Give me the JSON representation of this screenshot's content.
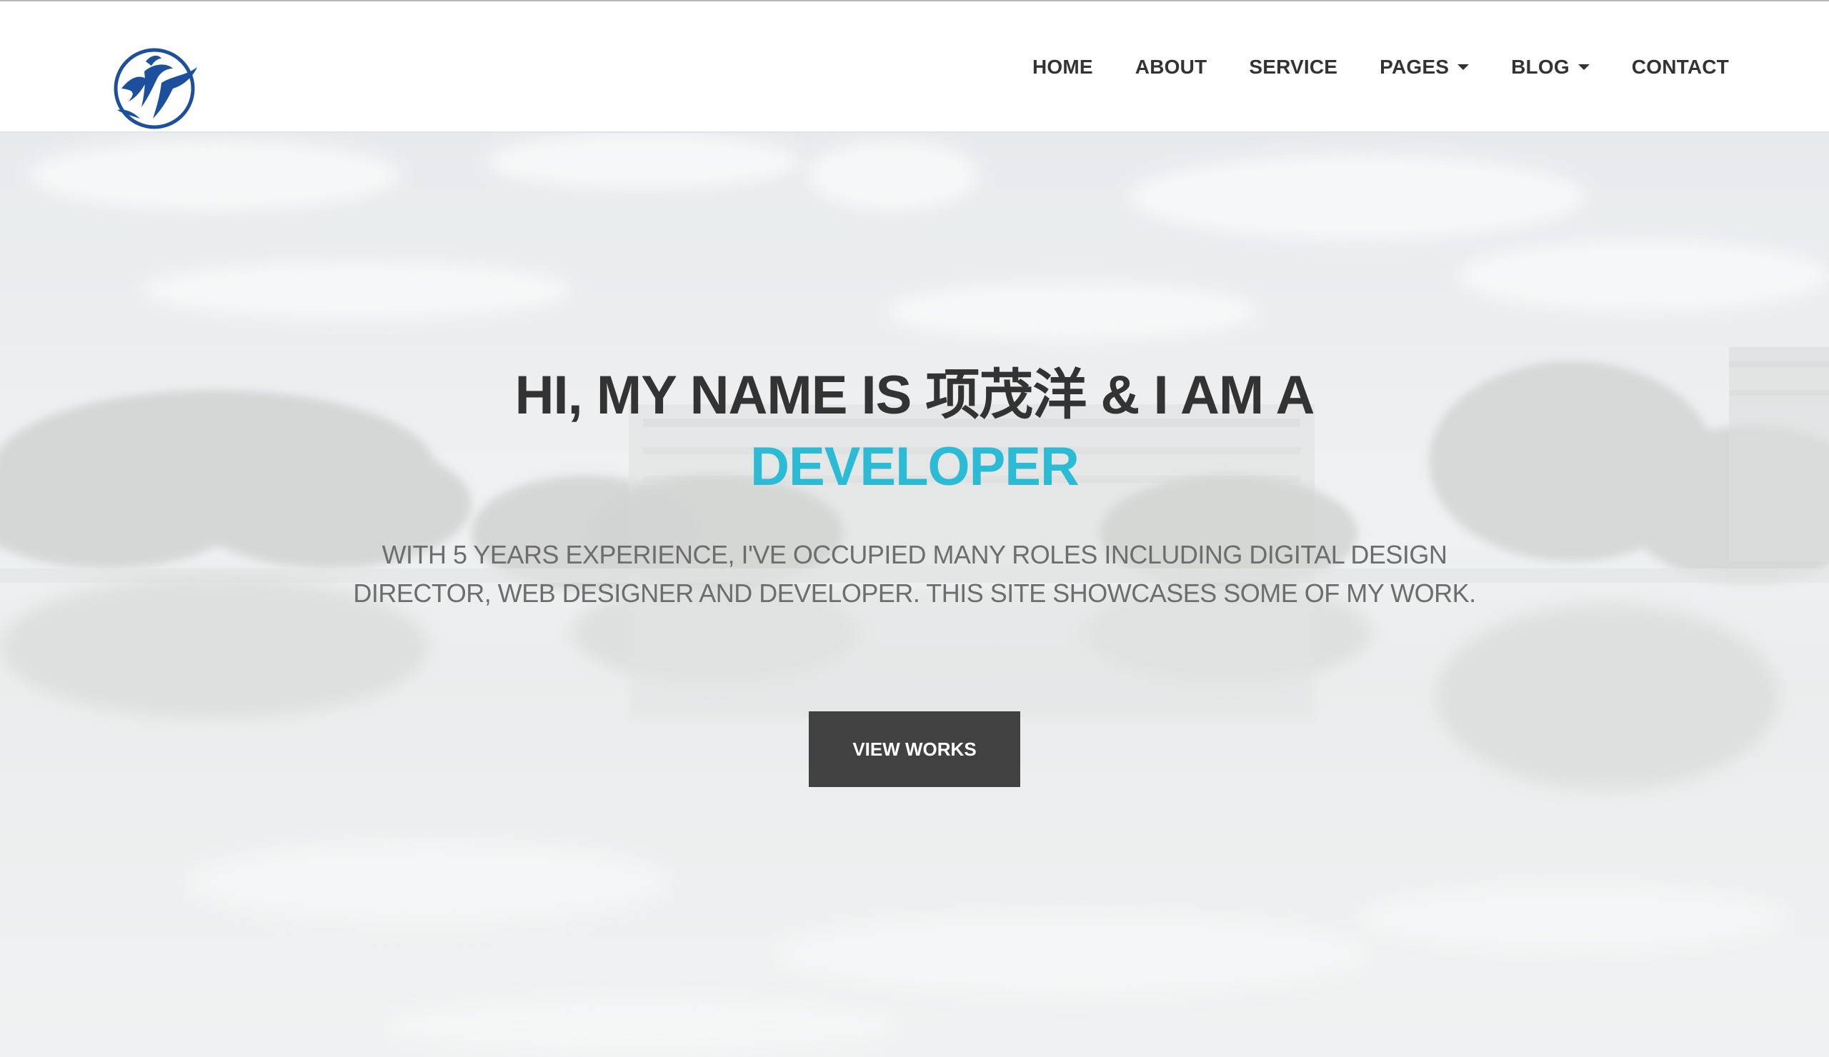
{
  "nav": {
    "items": [
      {
        "label": "HOME",
        "has_dropdown": false
      },
      {
        "label": "ABOUT",
        "has_dropdown": false
      },
      {
        "label": "SERVICE",
        "has_dropdown": false
      },
      {
        "label": "PAGES",
        "has_dropdown": true
      },
      {
        "label": "BLOG",
        "has_dropdown": true
      },
      {
        "label": "CONTACT",
        "has_dropdown": false
      }
    ],
    "logo_icon": "bird-emblem-logo"
  },
  "hero": {
    "headline": "HI, MY NAME IS 项茂洋 & I AM A",
    "role": "DEVELOPER",
    "intro": "WITH 5 YEARS EXPERIENCE, I'VE OCCUPIED MANY ROLES INCLUDING DIGITAL DESIGN DIRECTOR, WEB DESIGNER AND DEVELOPER. THIS SITE SHOWCASES SOME OF MY WORK.",
    "cta_label": "VIEW WORKS"
  },
  "colors": {
    "accent": "#2bbbd4",
    "heading": "#333333",
    "button": "#414141",
    "logo": "#1c4f9c"
  }
}
